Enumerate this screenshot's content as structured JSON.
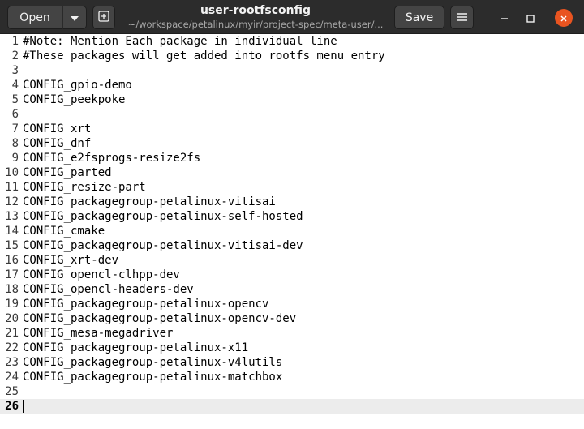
{
  "header": {
    "open_label": "Open",
    "save_label": "Save",
    "title": "user-rootfsconfig",
    "subtitle": "~/workspace/petalinux/myir/project-spec/meta-user/...",
    "close_color": "#e95420"
  },
  "editor": {
    "current_line": 26,
    "lines": [
      {
        "n": "1",
        "text": "#Note: Mention Each package in individual line"
      },
      {
        "n": "2",
        "text": "#These packages will get added into rootfs menu entry"
      },
      {
        "n": "3",
        "text": ""
      },
      {
        "n": "4",
        "text": "CONFIG_gpio-demo"
      },
      {
        "n": "5",
        "text": "CONFIG_peekpoke"
      },
      {
        "n": "6",
        "text": ""
      },
      {
        "n": "7",
        "text": "CONFIG_xrt"
      },
      {
        "n": "8",
        "text": "CONFIG_dnf"
      },
      {
        "n": "9",
        "text": "CONFIG_e2fsprogs-resize2fs"
      },
      {
        "n": "10",
        "text": "CONFIG_parted"
      },
      {
        "n": "11",
        "text": "CONFIG_resize-part"
      },
      {
        "n": "12",
        "text": "CONFIG_packagegroup-petalinux-vitisai"
      },
      {
        "n": "13",
        "text": "CONFIG_packagegroup-petalinux-self-hosted"
      },
      {
        "n": "14",
        "text": "CONFIG_cmake"
      },
      {
        "n": "15",
        "text": "CONFIG_packagegroup-petalinux-vitisai-dev"
      },
      {
        "n": "16",
        "text": "CONFIG_xrt-dev"
      },
      {
        "n": "17",
        "text": "CONFIG_opencl-clhpp-dev"
      },
      {
        "n": "18",
        "text": "CONFIG_opencl-headers-dev"
      },
      {
        "n": "19",
        "text": "CONFIG_packagegroup-petalinux-opencv"
      },
      {
        "n": "20",
        "text": "CONFIG_packagegroup-petalinux-opencv-dev"
      },
      {
        "n": "21",
        "text": "CONFIG_mesa-megadriver"
      },
      {
        "n": "22",
        "text": "CONFIG_packagegroup-petalinux-x11"
      },
      {
        "n": "23",
        "text": "CONFIG_packagegroup-petalinux-v4lutils"
      },
      {
        "n": "24",
        "text": "CONFIG_packagegroup-petalinux-matchbox"
      },
      {
        "n": "25",
        "text": ""
      },
      {
        "n": "26",
        "text": ""
      }
    ]
  }
}
